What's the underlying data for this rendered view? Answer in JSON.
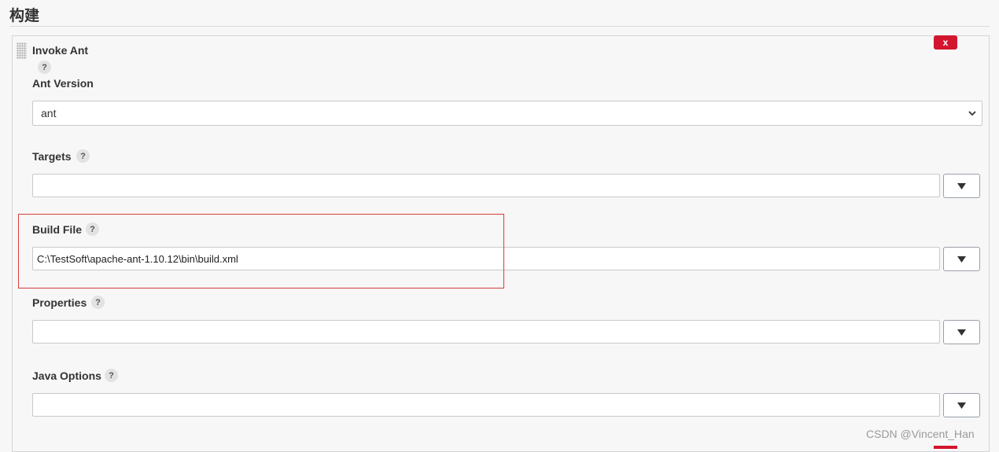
{
  "section": {
    "title": "构建"
  },
  "step": {
    "title": "Invoke Ant",
    "delete_label": "x",
    "help_label": "?"
  },
  "fields": {
    "ant_version": {
      "label": "Ant Version",
      "value": "ant"
    },
    "targets": {
      "label": "Targets",
      "value": "",
      "help_label": "?",
      "expand_label": "▼"
    },
    "build_file": {
      "label": "Build File",
      "value": "C:\\TestSoft\\apache-ant-1.10.12\\bin\\build.xml",
      "help_label": "?",
      "expand_label": "▼"
    },
    "properties": {
      "label": "Properties",
      "value": "",
      "help_label": "?",
      "expand_label": "▼"
    },
    "java_options": {
      "label": "Java Options",
      "value": "",
      "help_label": "?",
      "expand_label": "▼"
    }
  },
  "watermark": "CSDN @Vincent_Han",
  "colors": {
    "delete_button": "#d2162e",
    "highlight": "#d73c3c"
  }
}
